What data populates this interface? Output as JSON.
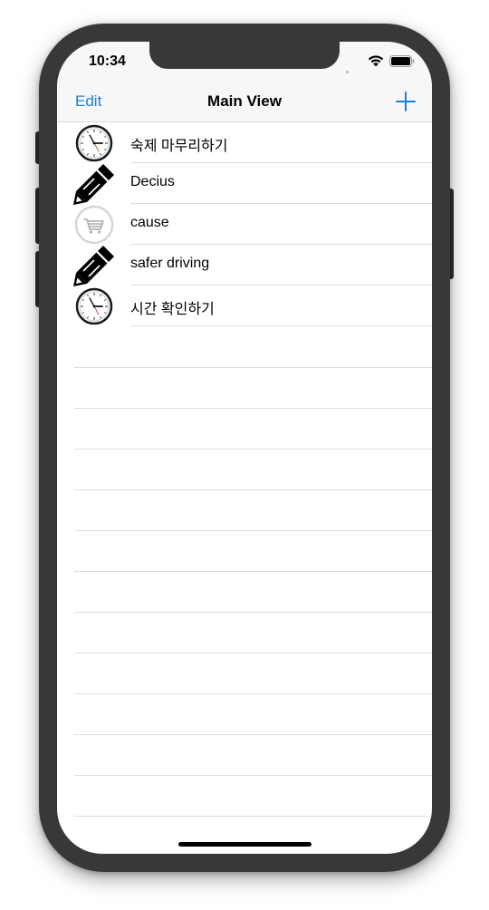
{
  "status_bar": {
    "time": "10:34"
  },
  "nav": {
    "edit_label": "Edit",
    "title": "Main View",
    "add_icon": "plus-icon"
  },
  "accent_color": "#1a7fdd",
  "list": {
    "items": [
      {
        "label": "숙제 마무리하기",
        "icon": "clock-icon"
      },
      {
        "label": "Decius",
        "icon": "pencil-icon"
      },
      {
        "label": "cause",
        "icon": "shopping-cart-icon"
      },
      {
        "label": "safer driving",
        "icon": "pencil-icon"
      },
      {
        "label": "시간 확인하기",
        "icon": "clock-icon"
      }
    ]
  }
}
